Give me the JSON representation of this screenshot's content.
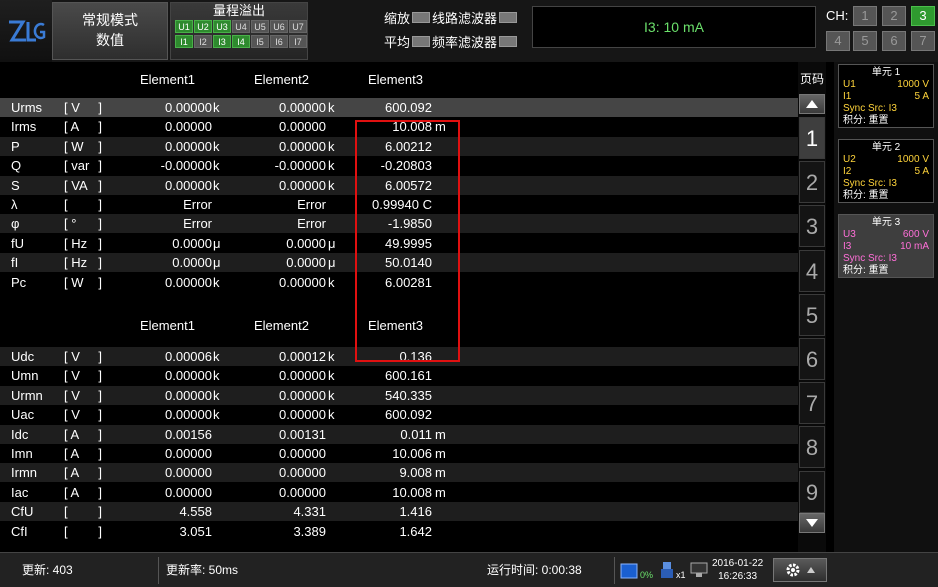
{
  "top": {
    "logo_text": "ZLG",
    "mode_line1": "常规模式",
    "mode_line2": "数值",
    "overflow_title": "量程溢出",
    "u_chips": [
      "U1",
      "U2",
      "U3",
      "U4",
      "U5",
      "U6",
      "U7"
    ],
    "u_chips_on": [
      true,
      true,
      true,
      false,
      false,
      false,
      false
    ],
    "i_chips": [
      "I1",
      "I2",
      "I3",
      "I4",
      "I5",
      "I6",
      "I7"
    ],
    "i_chips_on": [
      true,
      false,
      true,
      true,
      false,
      false,
      false
    ],
    "scale_label": "缩放",
    "line_filter_label": "线路滤波器",
    "average_label": "平均",
    "freq_filter_label": "频率滤波器",
    "message": "I3: 10 mA",
    "ch_label": "CH:",
    "ch_buttons": [
      "1",
      "2",
      "3",
      "4",
      "5",
      "6",
      "7"
    ],
    "ch_selected": "3"
  },
  "table1": {
    "headers": [
      "Element1",
      "Element2",
      "Element3"
    ],
    "rows": [
      {
        "name": "Urms",
        "unit": "V",
        "v1": "0.00000",
        "p1": "k",
        "v2": "0.00000",
        "p2": "k",
        "v3": "600.092",
        "p3": ""
      },
      {
        "name": "Irms",
        "unit": "A",
        "v1": "0.00000",
        "p1": "",
        "v2": "0.00000",
        "p2": "",
        "v3": "10.008",
        "p3": "m"
      },
      {
        "name": "P",
        "unit": "W",
        "v1": "0.00000",
        "p1": "k",
        "v2": "0.00000",
        "p2": "k",
        "v3": "6.00212",
        "p3": ""
      },
      {
        "name": "Q",
        "unit": "var",
        "v1": "-0.00000",
        "p1": "k",
        "v2": "-0.00000",
        "p2": "k",
        "v3": "-0.20803",
        "p3": ""
      },
      {
        "name": "S",
        "unit": "VA",
        "v1": "0.00000",
        "p1": "k",
        "v2": "0.00000",
        "p2": "k",
        "v3": "6.00572",
        "p3": ""
      },
      {
        "name": "λ",
        "unit": "",
        "v1": "Error",
        "p1": "",
        "v2": "Error",
        "p2": "",
        "v3": "0.99940 C",
        "p3": ""
      },
      {
        "name": "φ",
        "unit": "°",
        "v1": "Error",
        "p1": "",
        "v2": "Error",
        "p2": "",
        "v3": "-1.9850",
        "p3": ""
      },
      {
        "name": "fU",
        "unit": "Hz",
        "v1": "0.0000",
        "p1": "μ",
        "v2": "0.0000",
        "p2": "μ",
        "v3": "49.9995",
        "p3": ""
      },
      {
        "name": "fI",
        "unit": "Hz",
        "v1": "0.0000",
        "p1": "μ",
        "v2": "0.0000",
        "p2": "μ",
        "v3": "50.0140",
        "p3": ""
      },
      {
        "name": "Pc",
        "unit": "W",
        "v1": "0.00000",
        "p1": "k",
        "v2": "0.00000",
        "p2": "k",
        "v3": "6.00281",
        "p3": ""
      }
    ]
  },
  "table2": {
    "headers": [
      "Element1",
      "Element2",
      "Element3"
    ],
    "rows": [
      {
        "name": "Udc",
        "unit": "V",
        "v1": "0.00006",
        "p1": "k",
        "v2": "0.00012",
        "p2": "k",
        "v3": "0.136",
        "p3": ""
      },
      {
        "name": "Umn",
        "unit": "V",
        "v1": "0.00000",
        "p1": "k",
        "v2": "0.00000",
        "p2": "k",
        "v3": "600.161",
        "p3": ""
      },
      {
        "name": "Urmn",
        "unit": "V",
        "v1": "0.00000",
        "p1": "k",
        "v2": "0.00000",
        "p2": "k",
        "v3": "540.335",
        "p3": ""
      },
      {
        "name": "Uac",
        "unit": "V",
        "v1": "0.00000",
        "p1": "k",
        "v2": "0.00000",
        "p2": "k",
        "v3": "600.092",
        "p3": ""
      },
      {
        "name": "Idc",
        "unit": "A",
        "v1": "0.00156",
        "p1": "",
        "v2": "0.00131",
        "p2": "",
        "v3": "0.011",
        "p3": "m"
      },
      {
        "name": "Imn",
        "unit": "A",
        "v1": "0.00000",
        "p1": "",
        "v2": "0.00000",
        "p2": "",
        "v3": "10.006",
        "p3": "m"
      },
      {
        "name": "Irmn",
        "unit": "A",
        "v1": "0.00000",
        "p1": "",
        "v2": "0.00000",
        "p2": "",
        "v3": "9.008",
        "p3": "m"
      },
      {
        "name": "Iac",
        "unit": "A",
        "v1": "0.00000",
        "p1": "",
        "v2": "0.00000",
        "p2": "",
        "v3": "10.008",
        "p3": "m"
      },
      {
        "name": "CfU",
        "unit": "",
        "v1": "4.558",
        "p1": "",
        "v2": "4.331",
        "p2": "",
        "v3": "1.416",
        "p3": ""
      },
      {
        "name": "CfI",
        "unit": "",
        "v1": "3.051",
        "p1": "",
        "v2": "3.389",
        "p2": "",
        "v3": "1.642",
        "p3": ""
      }
    ]
  },
  "pages": {
    "title": "页码",
    "items": [
      "1",
      "2",
      "3",
      "4",
      "5",
      "6",
      "7",
      "8",
      "9"
    ],
    "selected": "1"
  },
  "units": [
    {
      "title": "单元 1",
      "u": "U1",
      "u_range": "1000 V",
      "i": "I1",
      "i_range": "5 A",
      "sync": "Sync Src: I3",
      "integ": "积分: 重置"
    },
    {
      "title": "单元 2",
      "u": "U2",
      "u_range": "1000 V",
      "i": "I2",
      "i_range": "5 A",
      "sync": "Sync Src: I3",
      "integ": "积分: 重置"
    },
    {
      "title": "单元 3",
      "u": "U3",
      "u_range": "600 V",
      "i": "I3",
      "i_range": "10 mA",
      "sync": "Sync Src: I3",
      "integ": "积分: 重置"
    }
  ],
  "status": {
    "update_count": "更新: 403",
    "update_rate": "更新率: 50ms",
    "run_time": "运行时间: 0:00:38",
    "disk_pct": "0%",
    "usb_count": "x1",
    "date": "2016-01-22",
    "time": "16:26:33"
  },
  "colors": {
    "accent_green": "#2f9a2f",
    "message_green": "#6be06b",
    "highlight_red": "#e01010",
    "unit_yellow": "#ffd43b",
    "unit_pink": "#ff6fd8"
  }
}
